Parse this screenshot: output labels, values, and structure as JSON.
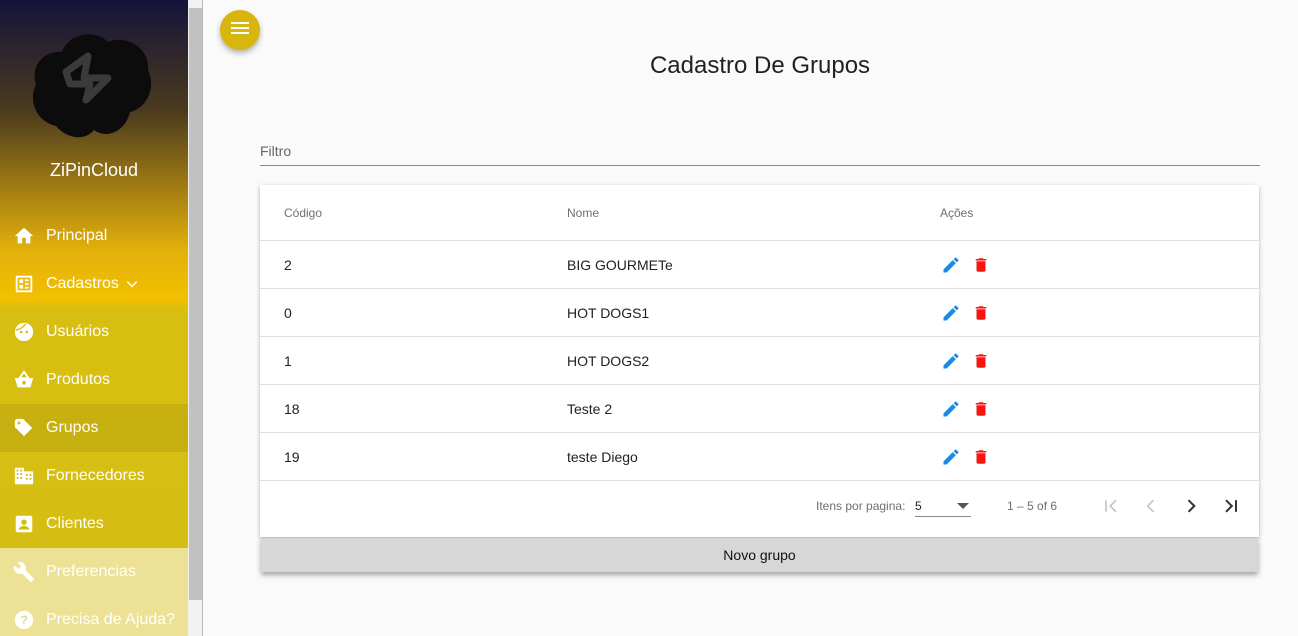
{
  "sidebar": {
    "brand": "ZiPinCloud",
    "items": [
      {
        "label": "Principal",
        "icon": "home-icon"
      },
      {
        "label": "Cadastros",
        "icon": "dashboard-icon"
      },
      {
        "label": "Usuários",
        "icon": "face-icon"
      },
      {
        "label": "Produtos",
        "icon": "basket-icon"
      },
      {
        "label": "Grupos",
        "icon": "tag-icon",
        "active": true
      },
      {
        "label": "Fornecedores",
        "icon": "building-icon"
      },
      {
        "label": "Clientes",
        "icon": "account-box-icon"
      },
      {
        "label": "Preferencias",
        "icon": "wrench-icon"
      },
      {
        "label": "Precisa de Ajuda?",
        "icon": "help-icon"
      }
    ]
  },
  "page": {
    "title": "Cadastro De Grupos",
    "filter_placeholder": "Filtro"
  },
  "table": {
    "columns": [
      "Código",
      "Nome",
      "Ações"
    ],
    "rows": [
      {
        "codigo": "2",
        "nome": "BIG GOURMETe"
      },
      {
        "codigo": "0",
        "nome": "HOT DOGS1"
      },
      {
        "codigo": "1",
        "nome": "HOT DOGS2"
      },
      {
        "codigo": "18",
        "nome": "Teste 2"
      },
      {
        "codigo": "19",
        "nome": "teste Diego"
      }
    ]
  },
  "paginator": {
    "per_page_label": "Itens por pagina:",
    "per_page_value": "5",
    "range_label": "1 – 5 of 6"
  },
  "actions": {
    "new_group_label": "Novo grupo"
  },
  "colors": {
    "accent": "#d8b60d",
    "edit": "#1e88e5",
    "delete": "#ff1111"
  }
}
